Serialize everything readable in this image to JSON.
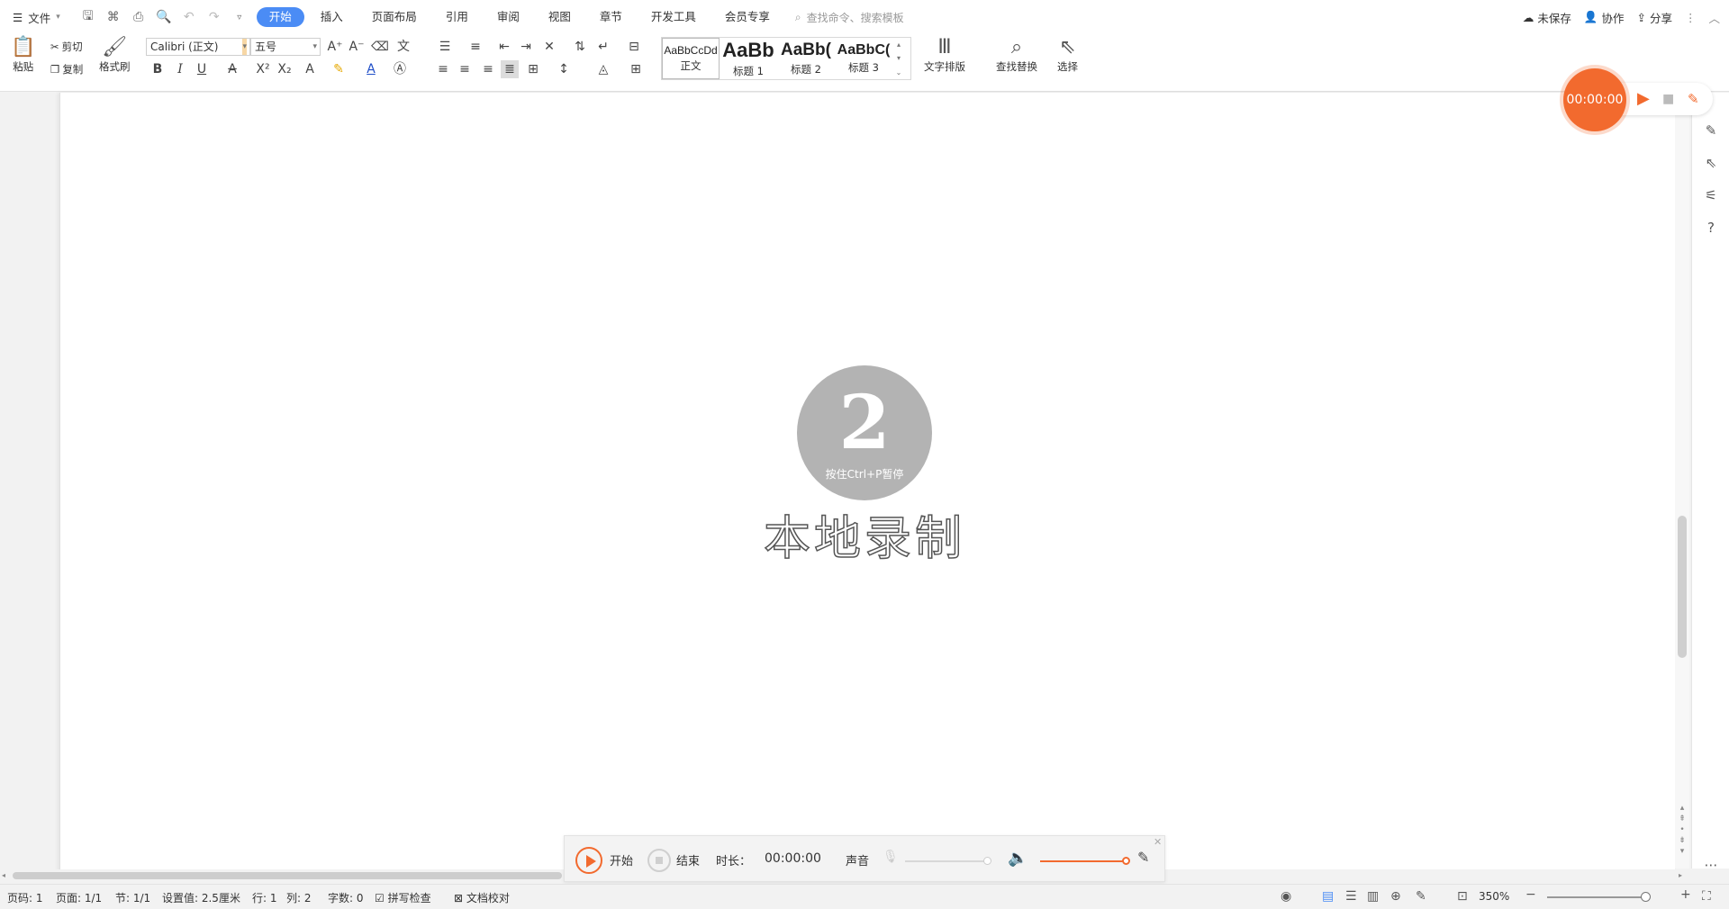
{
  "menubar": {
    "file_label": "文件",
    "tabs": [
      {
        "label": "开始",
        "active": true
      },
      {
        "label": "插入",
        "active": false
      },
      {
        "label": "页面布局",
        "active": false
      },
      {
        "label": "引用",
        "active": false
      },
      {
        "label": "审阅",
        "active": false
      },
      {
        "label": "视图",
        "active": false
      },
      {
        "label": "章节",
        "active": false
      },
      {
        "label": "开发工具",
        "active": false
      },
      {
        "label": "会员专享",
        "active": false
      }
    ],
    "search_placeholder": "查找命令、搜索模板",
    "right": {
      "unsaved": "未保存",
      "collaborate": "协作",
      "share": "分享"
    }
  },
  "ribbon": {
    "paste": "粘贴",
    "cut": "剪切",
    "copy": "复制",
    "format_painter": "格式刷",
    "font_name": "Calibri (正文)",
    "font_size": "五号",
    "styles": [
      {
        "sample": "AaBbCcDd",
        "caption": "正文"
      },
      {
        "sample": "AaBb",
        "caption": "标题 1"
      },
      {
        "sample": "AaBb(",
        "caption": "标题 2"
      },
      {
        "sample": "AaBbC(",
        "caption": "标题 3"
      }
    ],
    "text_layout": "文字排版",
    "find_replace": "查找替换",
    "select": "选择"
  },
  "document": {
    "countdown_number": "2",
    "countdown_hint": "按住Ctrl+P暂停",
    "local_record": "本地录制"
  },
  "recorder_widget": {
    "time": "00:00:00"
  },
  "recorder_bar": {
    "start": "开始",
    "end": "结束",
    "duration_label": "时长：",
    "duration": "00:00:00",
    "sound_label": "声音"
  },
  "statusbar": {
    "page_code": "页码: 1",
    "pages": "页面: 1/1",
    "section": "节: 1/1",
    "setting": "设置值: 2.5厘米",
    "row": "行: 1",
    "col": "列: 2",
    "word_count": "字数: 0",
    "spell_check": "拼写检查",
    "doc_proof": "文档校对",
    "zoom": "350%"
  },
  "colors": {
    "accent_blue": "#4b8cf5",
    "record_orange": "#f26a2e",
    "countdown_gray": "#b3b3b3"
  }
}
